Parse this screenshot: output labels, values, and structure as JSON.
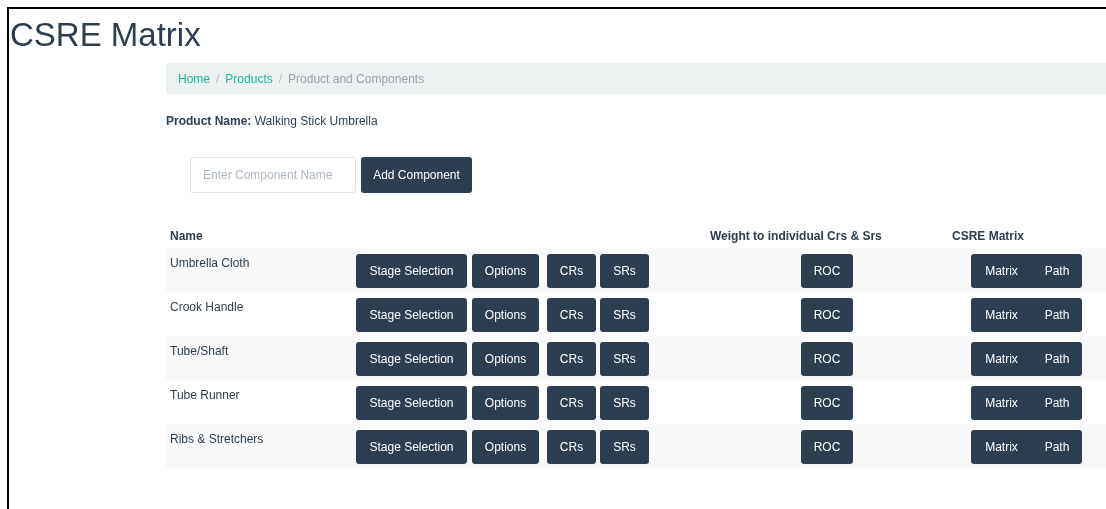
{
  "title": "CSRE Matrix",
  "breadcrumb": [
    {
      "label": "Home",
      "current": false
    },
    {
      "separator": "/",
      "label": "Products",
      "current": false
    },
    {
      "separator": "/",
      "label": "Product and Components",
      "current": true
    }
  ],
  "product": {
    "label": "Product Name:",
    "value": "Walking Stick Umbrella"
  },
  "add_form": {
    "placeholder": "Enter Component Name",
    "button": "Add Component"
  },
  "table": {
    "columns": [
      "Name",
      "Weight to individual Crs & Srs",
      "CSRE Matrix"
    ],
    "rows": [
      {
        "name": "Umbrella Cloth",
        "actions": [
          "Stage Selection",
          "Options",
          "CRs",
          "SRs"
        ],
        "weight": "ROC",
        "matrix": [
          "Matrix",
          "Path"
        ]
      },
      {
        "name": "Crook Handle",
        "actions": [
          "Stage Selection",
          "Options",
          "CRs",
          "SRs"
        ],
        "weight": "ROC",
        "matrix": [
          "Matrix",
          "Path"
        ]
      },
      {
        "name": "Tube/Shaft",
        "actions": [
          "Stage Selection",
          "Options",
          "CRs",
          "SRs"
        ],
        "weight": "ROC",
        "matrix": [
          "Matrix",
          "Path"
        ]
      },
      {
        "name": "Tube Runner",
        "actions": [
          "Stage Selection",
          "Options",
          "CRs",
          "SRs"
        ],
        "weight": "ROC",
        "matrix": [
          "Matrix",
          "Path"
        ]
      },
      {
        "name": "Ribs & Stretchers",
        "actions": [
          "Stage Selection",
          "Options",
          "CRs",
          "SRs"
        ],
        "weight": "ROC",
        "matrix": [
          "Matrix",
          "Path"
        ]
      }
    ]
  }
}
